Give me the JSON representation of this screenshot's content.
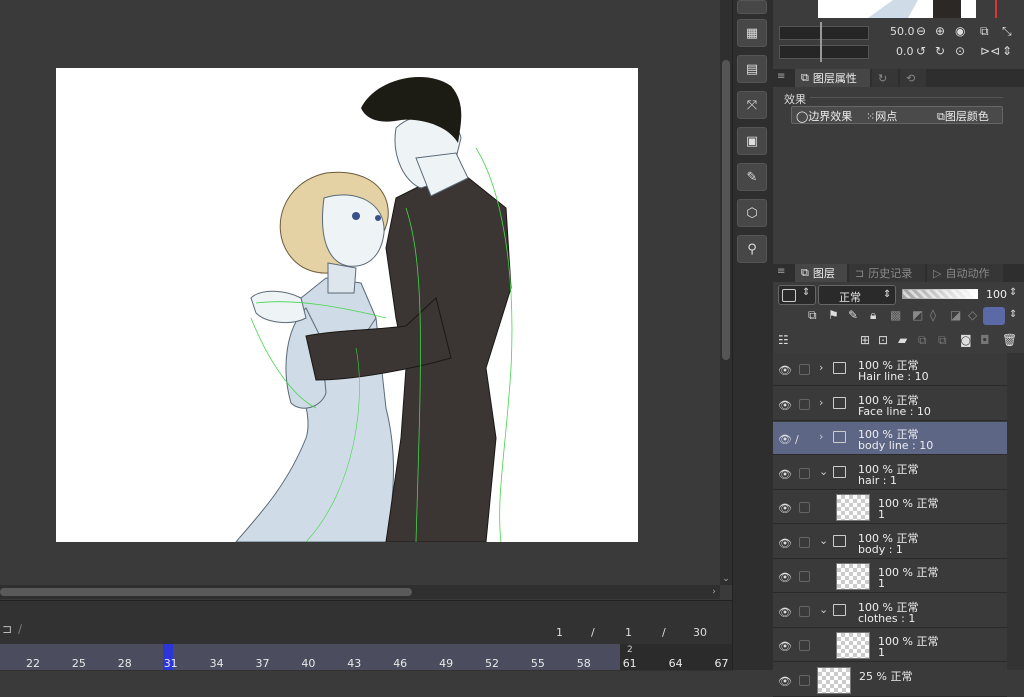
{
  "timeline": {
    "frame_current": "1",
    "sep1": "/",
    "frame_total_a": "1",
    "sep2": "/",
    "frame_total_b": "30",
    "ticks": [
      "22",
      "25",
      "28",
      "31",
      "34",
      "37",
      "40",
      "43",
      "46",
      "49",
      "52",
      "55",
      "58",
      "61",
      "64",
      "67"
    ],
    "tick_extra": "2"
  },
  "controls": {
    "brush_size": "50.0",
    "rotation": "0.0"
  },
  "property_panel": {
    "tab_active": "图层属性",
    "effects_title": "效果",
    "effects": [
      "边界效果",
      "网点",
      "图层颜色"
    ]
  },
  "layer_panel": {
    "tabs": [
      "图层",
      "历史记录",
      "自动动作"
    ],
    "blend_mode": "正常",
    "opacity": "100",
    "layers": [
      {
        "top": "100 %  正常",
        "name": "Hair line : 10",
        "type": "folder",
        "indent": 0,
        "expanded": false,
        "selected": false
      },
      {
        "top": "100 %  正常",
        "name": "Face line : 10",
        "type": "folder",
        "indent": 0,
        "expanded": false,
        "selected": false
      },
      {
        "top": "100 %  正常",
        "name": "body line : 10",
        "type": "folder",
        "indent": 0,
        "expanded": false,
        "selected": true
      },
      {
        "top": "100 %  正常",
        "name": "hair : 1",
        "type": "animfolder",
        "indent": 0,
        "expanded": true,
        "selected": false
      },
      {
        "top": "100 %  正常",
        "name": "1",
        "type": "raster",
        "indent": 1,
        "selected": false
      },
      {
        "top": "100 %  正常",
        "name": "body : 1",
        "type": "animfolder",
        "indent": 0,
        "expanded": true,
        "selected": false
      },
      {
        "top": "100 %  正常",
        "name": "1",
        "type": "raster",
        "indent": 1,
        "selected": false
      },
      {
        "top": "100 %  正常",
        "name": "clothes : 1",
        "type": "animfolder",
        "indent": 0,
        "expanded": true,
        "selected": false
      },
      {
        "top": "100 %  正常",
        "name": "1",
        "type": "raster",
        "indent": 1,
        "selected": false
      },
      {
        "top": "25 %  正常",
        "name": "",
        "type": "raster",
        "indent": 0,
        "selected": false
      }
    ]
  },
  "colors": {
    "selected_row": "#5d6685",
    "playhead": "#2c36d8",
    "suit": "#3b3633",
    "dress": "#cfdbe6",
    "hair_blonde": "#e4d2a5"
  }
}
